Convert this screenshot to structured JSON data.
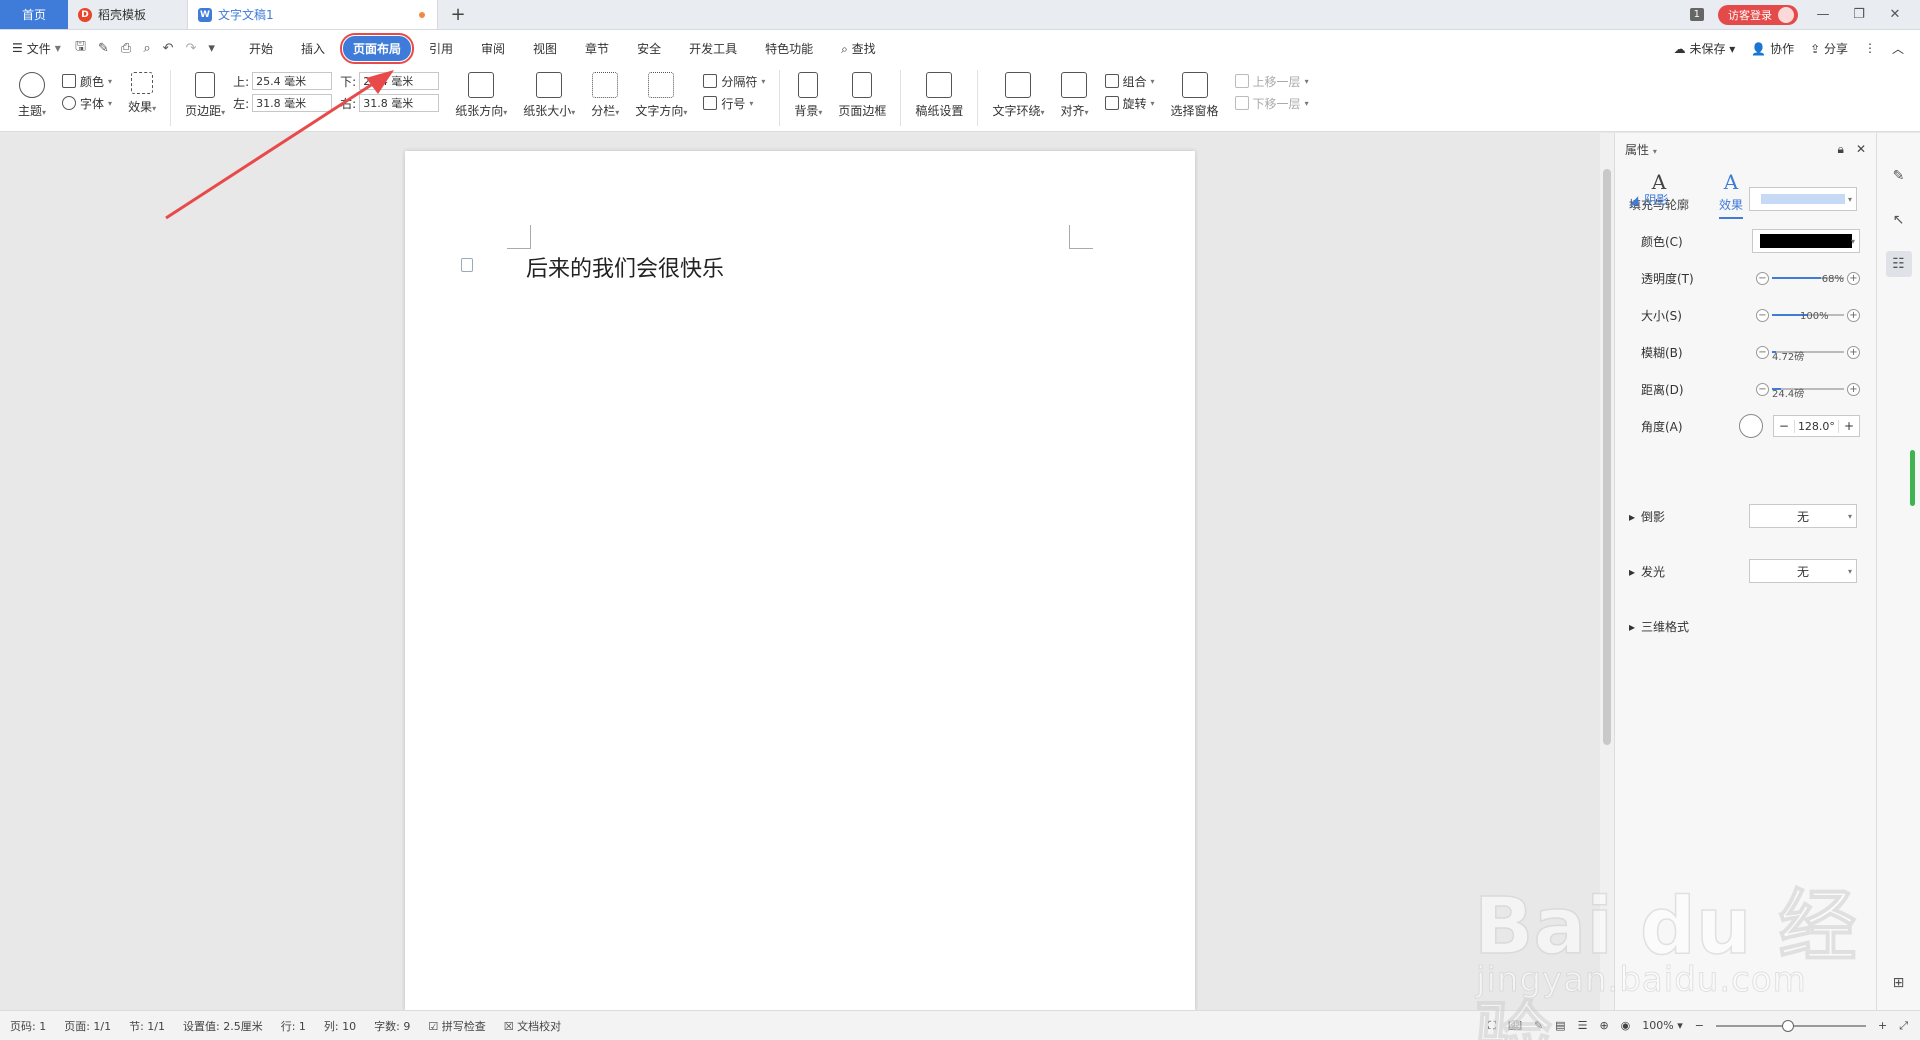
{
  "tabs": {
    "home": "首页",
    "docer": "稻壳模板",
    "document": "文字文稿1",
    "add": "+"
  },
  "titlebar": {
    "badge": "1",
    "login": "访客登录"
  },
  "menubar": {
    "file": "文件",
    "tabs": [
      "开始",
      "插入",
      "页面布局",
      "引用",
      "审阅",
      "视图",
      "章节",
      "安全",
      "开发工具",
      "特色功能"
    ],
    "search": "查找",
    "unsaved": "未保存",
    "collaborate": "协作",
    "share": "分享"
  },
  "ribbon": {
    "theme": "主题",
    "colors": "颜色",
    "fonts": "字体",
    "effects": "效果",
    "margins": "页边距",
    "margin_top_label": "上:",
    "margin_top": "25.4 毫米",
    "margin_bottom_label": "下:",
    "margin_bottom": "25.4 毫米",
    "margin_left_label": "左:",
    "margin_left": "31.8 毫米",
    "margin_right_label": "右:",
    "margin_right": "31.8 毫米",
    "orientation": "纸张方向",
    "size": "纸张大小",
    "columns": "分栏",
    "text_direction": "文字方向",
    "breaks": "分隔符",
    "line_numbers": "行号",
    "background": "背景",
    "page_border": "页面边框",
    "manuscript": "稿纸设置",
    "text_wrap": "文字环绕",
    "align": "对齐",
    "group": "组合",
    "rotate": "旋转",
    "selection_pane": "选择窗格",
    "bring_forward": "上移一层",
    "send_backward": "下移一层"
  },
  "document": {
    "text": "后来的我们会很快乐"
  },
  "panel": {
    "title": "属性",
    "tab_fill": "填充与轮廓",
    "tab_effects": "效果",
    "shadow": "阴影",
    "color": "颜色(C)",
    "transparency": "透明度(T)",
    "transparency_val": "68%",
    "transparency_pct": 68,
    "size": "大小(S)",
    "size_val": "100%",
    "size_pct": 50,
    "blur": "模糊(B)",
    "blur_val": "4.72磅",
    "blur_pct": 5,
    "distance": "距离(D)",
    "distance_val": "24.4磅",
    "distance_pct": 12,
    "angle": "角度(A)",
    "angle_val": "128.0°",
    "reflection": "倒影",
    "reflection_val": "无",
    "glow": "发光",
    "glow_val": "无",
    "three_d": "三维格式"
  },
  "status": {
    "page_num": "页码: 1",
    "pages": "页面: 1/1",
    "section": "节: 1/1",
    "setting": "设置值: 2.5厘米",
    "row": "行: 1",
    "col": "列: 10",
    "words": "字数: 9",
    "spell": "拼写检查",
    "proof": "文档校对",
    "zoom": "100%"
  },
  "watermark": {
    "main": "Bai du 经验",
    "sub": "jingyan.baidu.com"
  },
  "colors": {
    "accent": "#3f7bd8",
    "annotation": "#e84a4a",
    "login": "#e54a4a"
  }
}
